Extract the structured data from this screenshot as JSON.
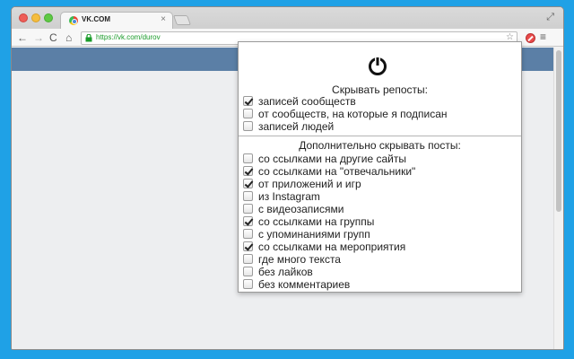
{
  "browser": {
    "tab_title": "VK.COM",
    "tab_close": "×",
    "url": "https://vk.com/durov",
    "nav_back": "←",
    "nav_forward": "→",
    "nav_reload": "C",
    "nav_home": "⌂",
    "star": "☆",
    "menu": "≡",
    "maximize": "⤢"
  },
  "popup": {
    "section1_title": "Скрывать репосты:",
    "section1_options": [
      {
        "label": "записей сообществ",
        "checked": true
      },
      {
        "label": "от сообществ, на которые я подписан",
        "checked": false
      },
      {
        "label": "записей людей",
        "checked": false
      }
    ],
    "section2_title": "Дополнительно скрывать посты:",
    "section2_options": [
      {
        "label": "со ссылками на другие сайты",
        "checked": false
      },
      {
        "label": "со ссылками на \"отвечальники\"",
        "checked": true
      },
      {
        "label": "от приложений и игр",
        "checked": true
      },
      {
        "label": "из Instagram",
        "checked": false
      },
      {
        "label": "с видеозаписями",
        "checked": false
      },
      {
        "label": "со ссылками на группы",
        "checked": true
      },
      {
        "label": "с упоминаниями групп",
        "checked": false
      },
      {
        "label": "со ссылками на мероприятия",
        "checked": true
      },
      {
        "label": "где много текста",
        "checked": false
      },
      {
        "label": "без лайков",
        "checked": false
      },
      {
        "label": "без комментариев",
        "checked": false
      }
    ]
  },
  "colors": {
    "desktop": "#1fa1e6",
    "vk_header": "#5b7fa6",
    "page_bg": "#edeef0",
    "url_green": "#1a9b2a"
  },
  "icons": [
    "power-icon",
    "lock-icon",
    "star-icon",
    "extension-icon",
    "menu-icon"
  ]
}
